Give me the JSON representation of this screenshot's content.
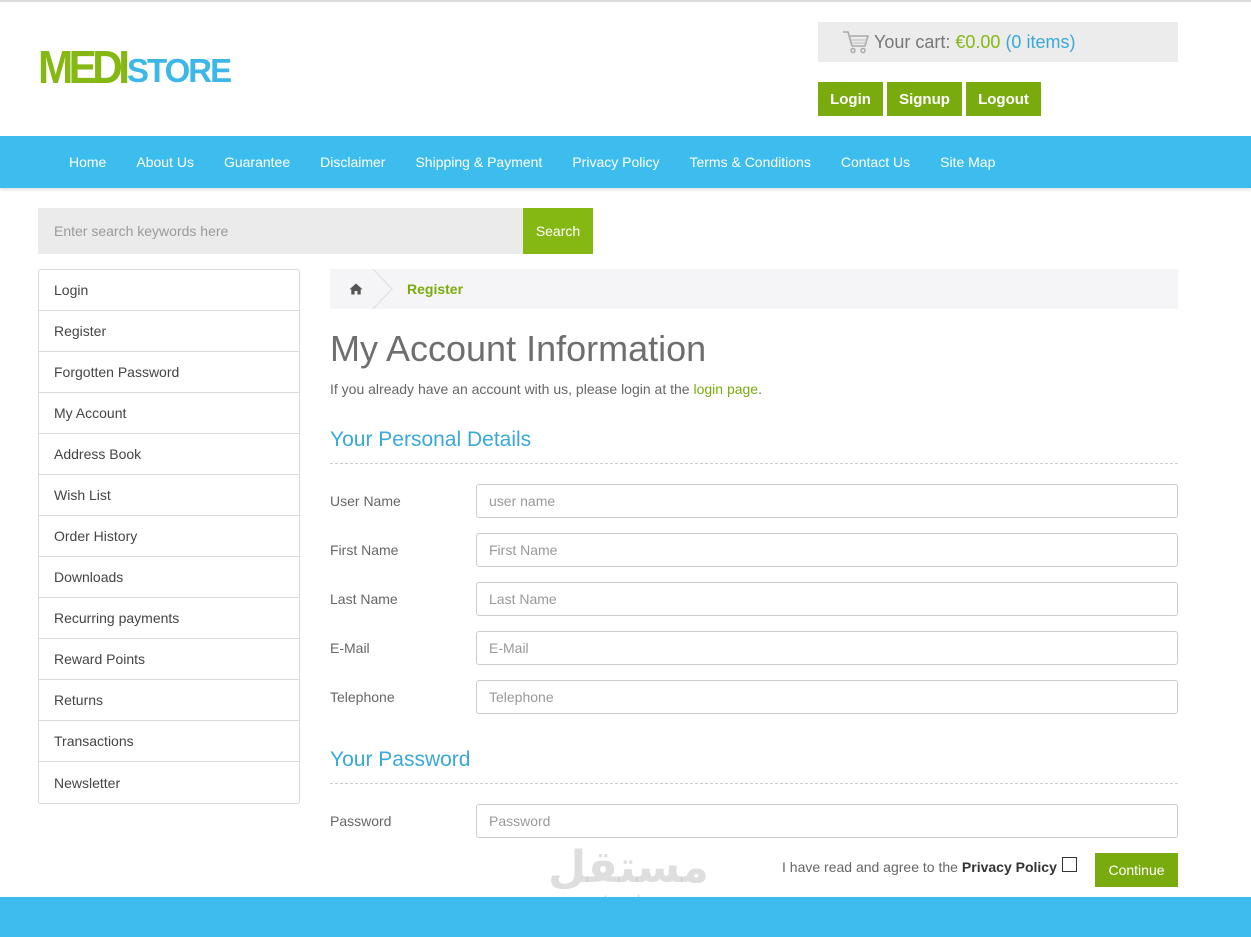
{
  "logo": {
    "part1": "MEDI",
    "part2": "STORE"
  },
  "cart": {
    "label": "Your cart:",
    "total": "€0.00",
    "items": "(0 items)"
  },
  "account_buttons": {
    "login": "Login",
    "signup": "Signup",
    "logout": "Logout"
  },
  "nav": [
    "Home",
    "About Us",
    "Guarantee",
    "Disclaimer",
    "Shipping & Payment",
    "Privacy Policy",
    "Terms & Conditions",
    "Contact Us",
    "Site Map"
  ],
  "search": {
    "placeholder": "Enter search keywords here",
    "button": "Search"
  },
  "sidebar": [
    "Login",
    "Register",
    "Forgotten Password",
    "My Account",
    "Address Book",
    "Wish List",
    "Order History",
    "Downloads",
    "Recurring payments",
    "Reward Points",
    "Returns",
    "Transactions",
    "Newsletter"
  ],
  "breadcrumb": {
    "current": "Register"
  },
  "page": {
    "title": "My Account Information",
    "intro_text": "If you already have an account with us, please login at the",
    "intro_link": "login page",
    "intro_end": "."
  },
  "personal": {
    "title": "Your Personal Details",
    "fields": [
      {
        "label": "User Name",
        "placeholder": "user name"
      },
      {
        "label": "First Name",
        "placeholder": "First Name"
      },
      {
        "label": "Last Name",
        "placeholder": "Last Name"
      },
      {
        "label": "E-Mail",
        "placeholder": "E-Mail"
      },
      {
        "label": "Telephone",
        "placeholder": "Telephone"
      }
    ]
  },
  "password": {
    "title": "Your Password",
    "label": "Password",
    "placeholder": "Password"
  },
  "agree": {
    "text": "I have read and agree to the",
    "link": "Privacy Policy"
  },
  "continue": "Continue",
  "watermark": {
    "arabic": "مستقل",
    "latin": "mostaql.com"
  },
  "colors": {
    "green": "#7aab0e",
    "blue": "#3cbdee",
    "heading_blue": "#3aa8d8"
  }
}
